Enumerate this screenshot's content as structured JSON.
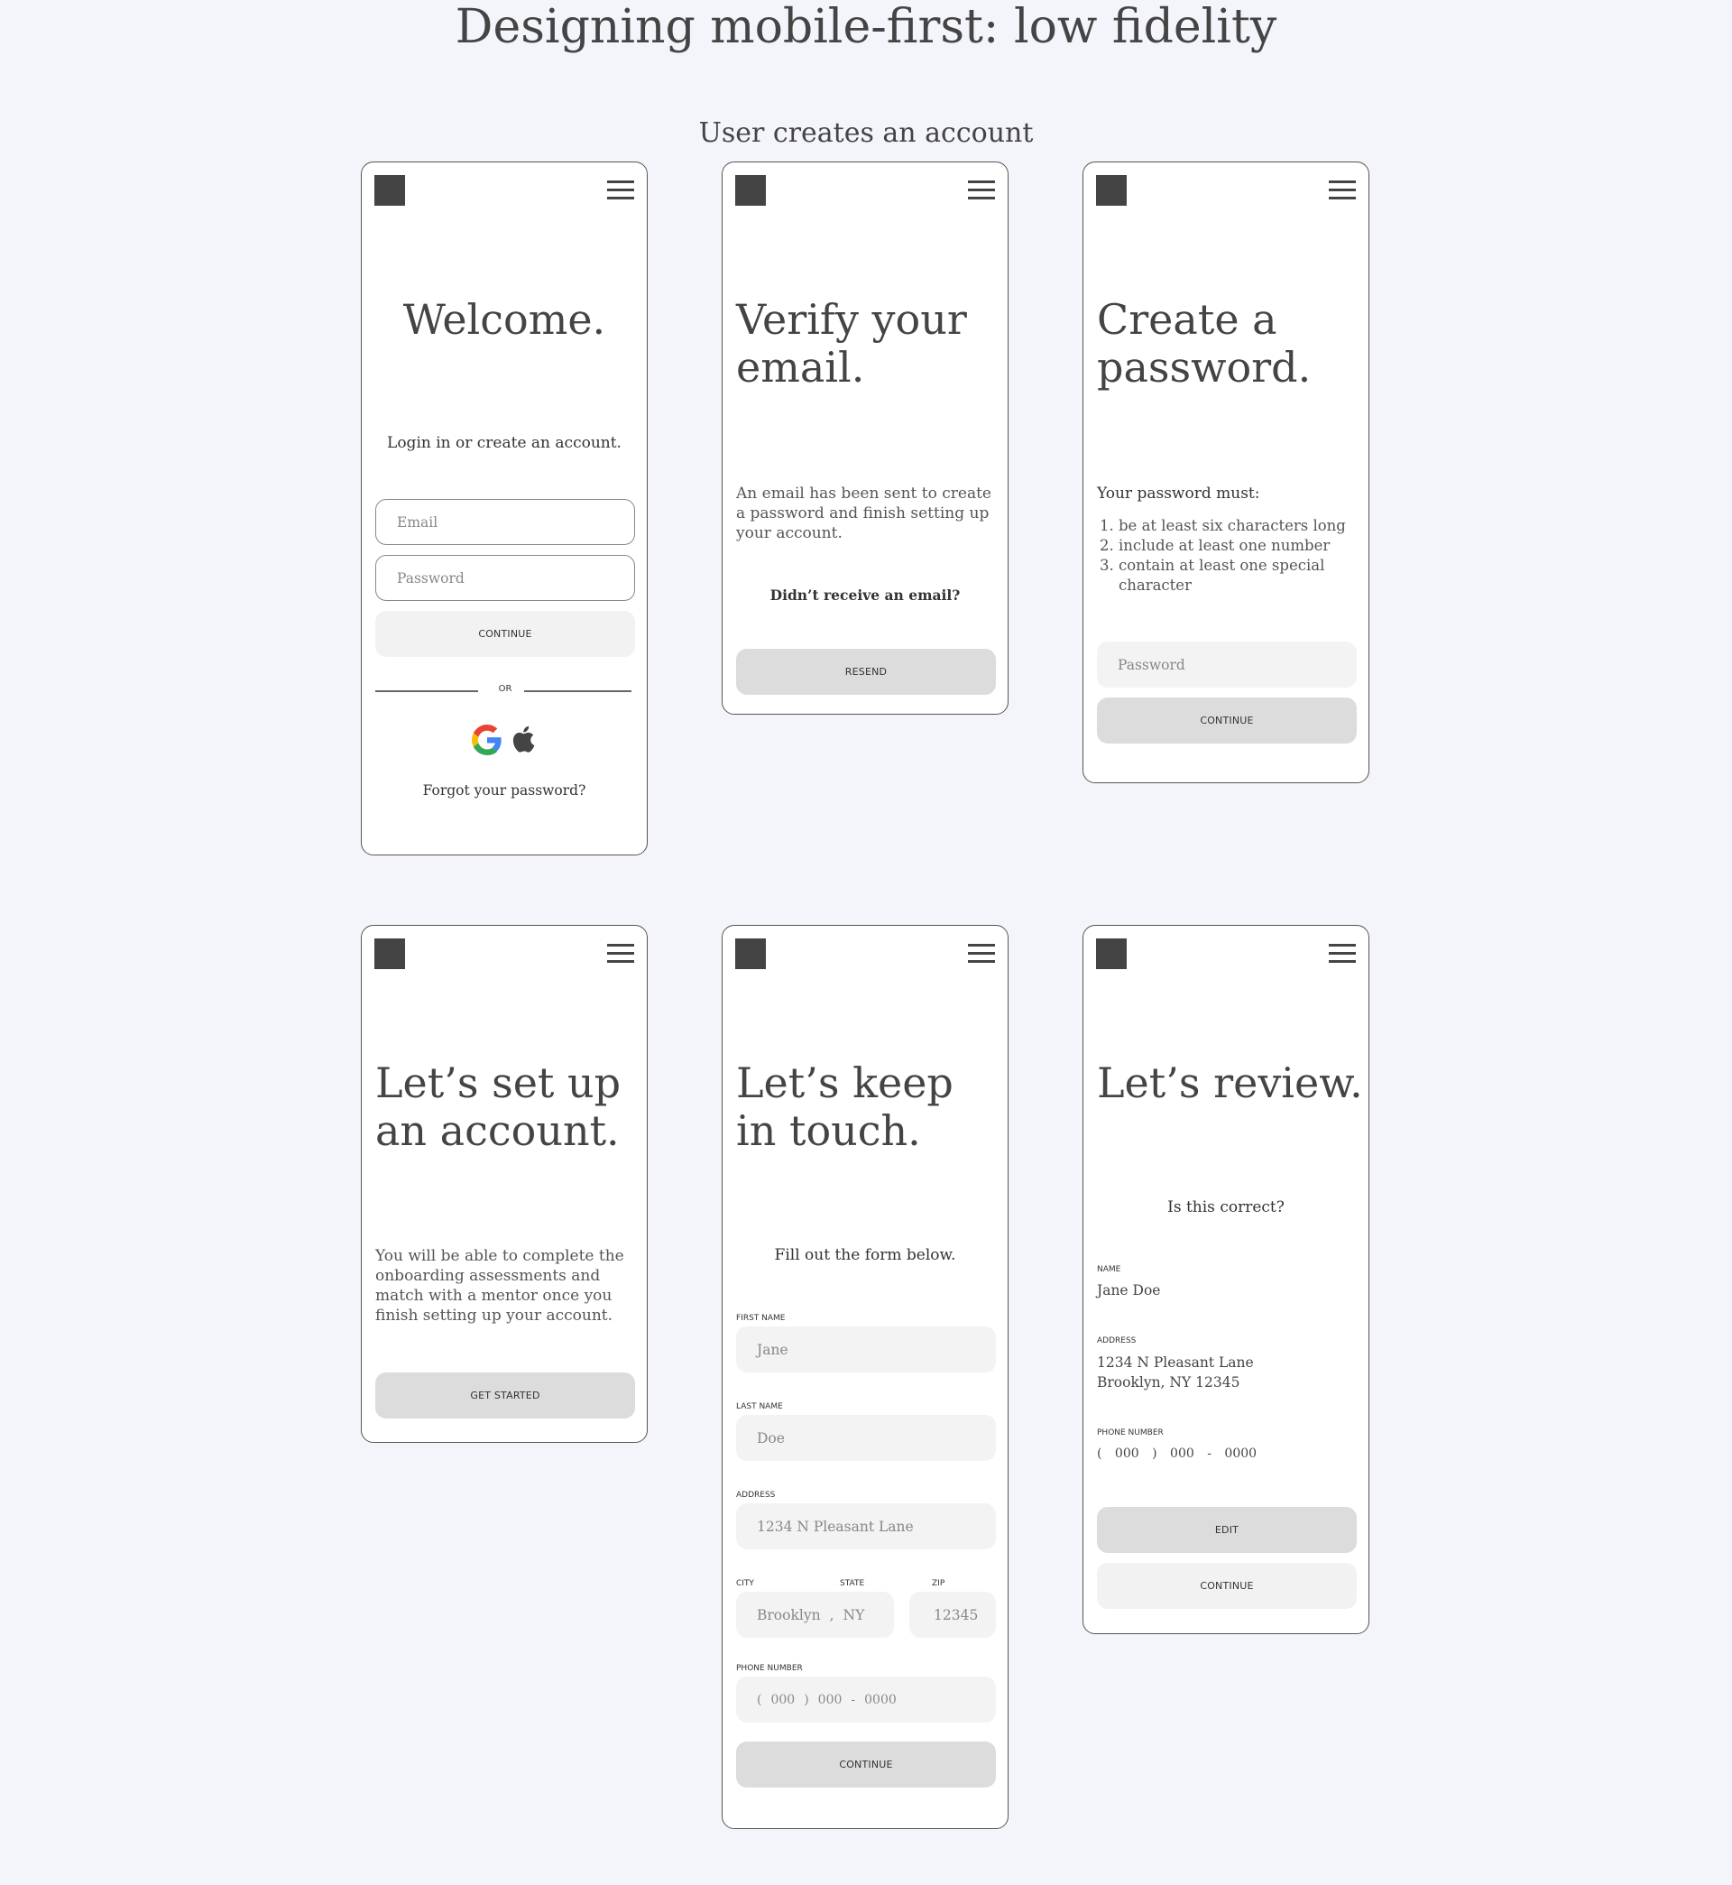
{
  "page": {
    "title": "Designing mobile-first: low fidelity",
    "section": "User creates an account"
  },
  "screens": {
    "welcome": {
      "heading": "Welcome.",
      "subtitle": "Login in or create an account.",
      "email_placeholder": "Email",
      "password_placeholder": "Password",
      "continue_label": "CONTINUE",
      "or_label": "OR",
      "social_icons": [
        "google-icon",
        "apple-icon"
      ],
      "forgot_label": "Forgot your password?"
    },
    "verify": {
      "heading": "Verify your email.",
      "body": "An email has been sent to create a password and finish setting up your account.",
      "prompt": "Didn’t receive an email?",
      "resend_label": "RESEND"
    },
    "password": {
      "heading": "Create a password.",
      "rules_title": "Your password must:",
      "rules": [
        "be at least six characters long",
        "include at least one number",
        "contain at least one special character"
      ],
      "password_placeholder": "Password",
      "continue_label": "CONTINUE"
    },
    "setup": {
      "heading": "Let’s set up an account.",
      "body": "You will be able to complete the onboarding assessments and match with a mentor once you finish setting up your account.",
      "get_started_label": "GET STARTED"
    },
    "contact": {
      "heading": "Let’s keep in touch.",
      "subtitle": "Fill out the form below.",
      "first_name_label": "FIRST NAME",
      "first_name_value": "Jane",
      "last_name_label": "LAST NAME",
      "last_name_value": "Doe",
      "address_label": "ADDRESS",
      "address_value": "1234 N Pleasant Lane",
      "city_label": "CITY",
      "state_label": "STATE",
      "zip_label": "ZIP",
      "city_value": "Brooklyn",
      "city_state_separator": ",",
      "state_value": "NY",
      "zip_value": "12345",
      "phone_label": "PHONE NUMBER",
      "phone_open": "(",
      "phone_area": "000",
      "phone_close": ")",
      "phone_prefix": "000",
      "phone_dash": "-",
      "phone_line": "0000",
      "continue_label": "CONTINUE"
    },
    "review": {
      "heading": "Let’s review.",
      "subtitle": "Is this correct?",
      "name_label": "NAME",
      "name_value": "Jane Doe",
      "address_label": "ADDRESS",
      "address_line1": "1234 N Pleasant Lane",
      "address_line2": "Brooklyn, NY 12345",
      "phone_label": "PHONE NUMBER",
      "phone_open": "(",
      "phone_area": "000",
      "phone_close": ")",
      "phone_prefix": "000",
      "phone_dash": "-",
      "phone_line": "0000",
      "edit_label": "EDIT",
      "continue_label": "CONTINUE"
    }
  }
}
